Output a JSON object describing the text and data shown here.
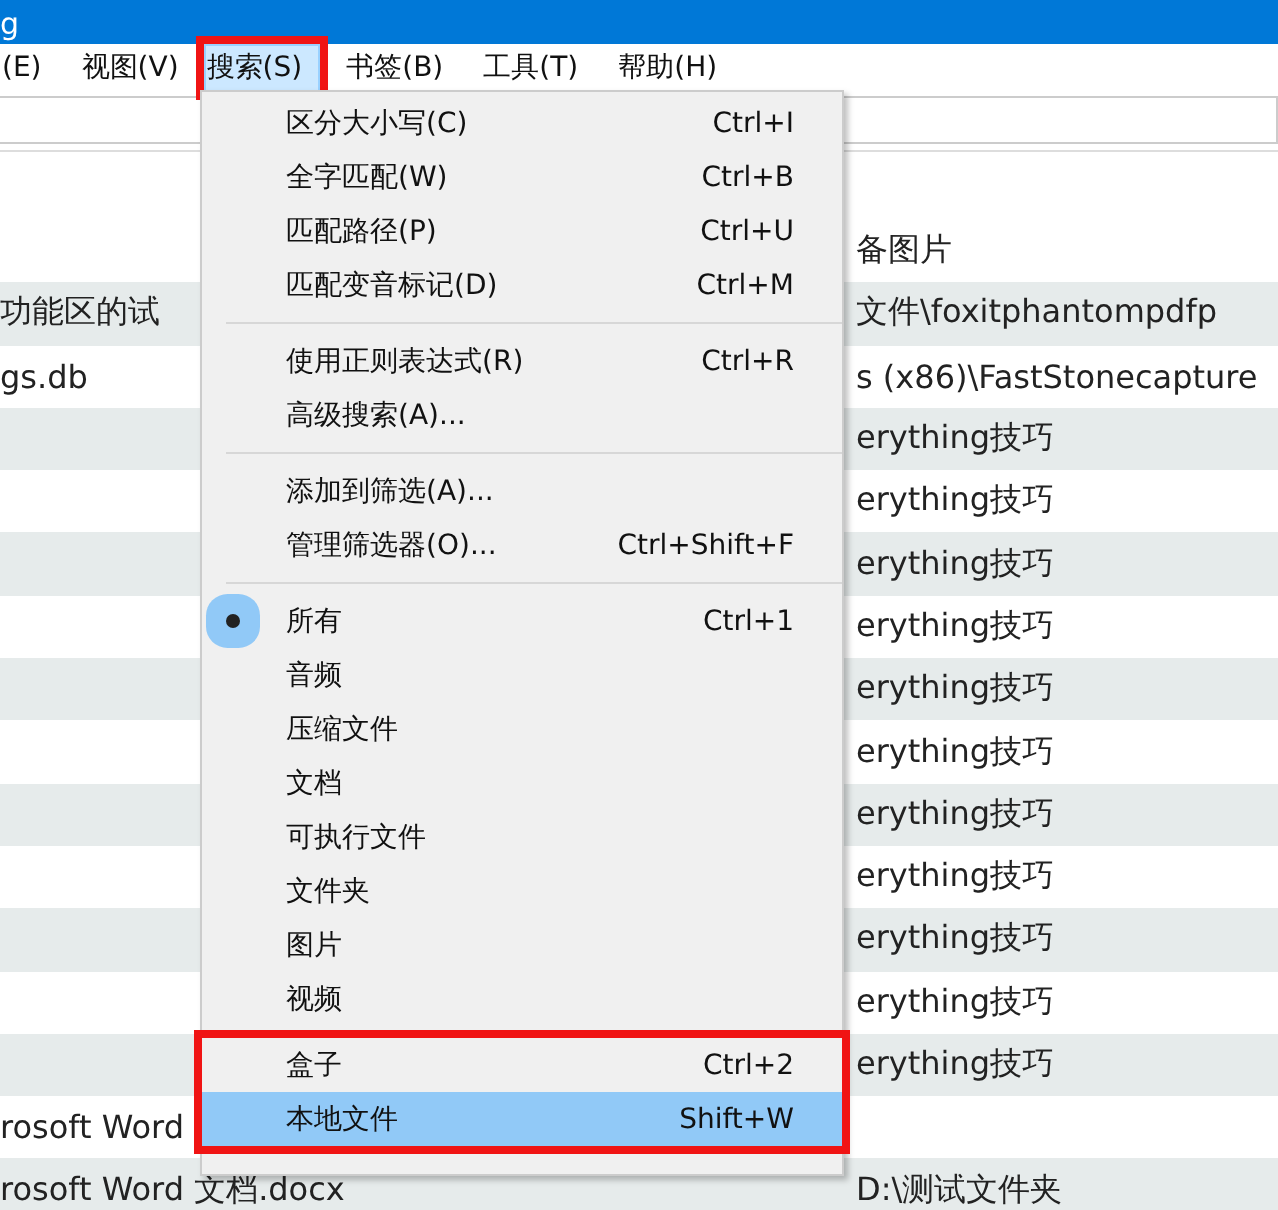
{
  "window": {
    "title": "g"
  },
  "menu_bar": [
    {
      "label": "(E)",
      "selected": false,
      "annotated": false
    },
    {
      "label": "视图(V)",
      "selected": false,
      "annotated": false
    },
    {
      "label": "搜索(S)",
      "selected": true,
      "annotated": true
    },
    {
      "label": "书签(B)",
      "selected": false,
      "annotated": false
    },
    {
      "label": "工具(T)",
      "selected": false,
      "annotated": false
    },
    {
      "label": "帮助(H)",
      "selected": false,
      "annotated": false
    }
  ],
  "file_list": {
    "rows": [
      {
        "column_1": "",
        "column_2": "备图片"
      },
      {
        "column_1": "功能区的试",
        "column_2": "文件\\foxitphantompdfp"
      },
      {
        "column_1": "gs.db",
        "column_2": "s (x86)\\FastStonecapture"
      },
      {
        "column_1": "",
        "column_2": "erything技巧"
      },
      {
        "column_1": "",
        "column_2": "erything技巧"
      },
      {
        "column_1": "",
        "column_2": "erything技巧"
      },
      {
        "column_1": "",
        "column_2": "erything技巧"
      },
      {
        "column_1": "",
        "column_2": "erything技巧"
      },
      {
        "column_1": "",
        "column_2": "erything技巧"
      },
      {
        "column_1": "",
        "column_2": "erything技巧"
      },
      {
        "column_1": "",
        "column_2": "erything技巧"
      },
      {
        "column_1": "",
        "column_2": "erything技巧"
      },
      {
        "column_1": "",
        "column_2": "erything技巧"
      },
      {
        "column_1": "",
        "column_2": "erything技巧"
      },
      {
        "column_1": "rosoft Word",
        "column_2": ""
      },
      {
        "column_1": "rosoft Word 文档.docx",
        "column_2": "D:\\测试文件夹"
      }
    ]
  },
  "menu": {
    "items": [
      {
        "kind": "item",
        "label": "区分大小写(C)",
        "shortcut": "Ctrl+I",
        "checked": false,
        "selected": false,
        "annotated": false
      },
      {
        "kind": "item",
        "label": "全字匹配(W)",
        "shortcut": "Ctrl+B",
        "checked": false,
        "selected": false,
        "annotated": false
      },
      {
        "kind": "item",
        "label": "匹配路径(P)",
        "shortcut": "Ctrl+U",
        "checked": false,
        "selected": false,
        "annotated": false
      },
      {
        "kind": "item",
        "label": "匹配变音标记(D)",
        "shortcut": "Ctrl+M",
        "checked": false,
        "selected": false,
        "annotated": false
      },
      {
        "kind": "separator"
      },
      {
        "kind": "item",
        "label": "使用正则表达式(R)",
        "shortcut": "Ctrl+R",
        "checked": false,
        "selected": false,
        "annotated": false
      },
      {
        "kind": "item",
        "label": "高级搜索(A)...",
        "checked": false,
        "selected": false,
        "annotated": false
      },
      {
        "kind": "separator"
      },
      {
        "kind": "item",
        "label": "添加到筛选(A)...",
        "checked": false,
        "selected": false,
        "annotated": false
      },
      {
        "kind": "item",
        "label": "管理筛选器(O)...",
        "shortcut": "Ctrl+Shift+F",
        "checked": false,
        "selected": false,
        "annotated": false
      },
      {
        "kind": "separator"
      },
      {
        "kind": "item",
        "label": "所有",
        "shortcut": "Ctrl+1",
        "checked": true,
        "selected": false,
        "annotated": false
      },
      {
        "kind": "item",
        "label": "音频",
        "checked": false,
        "selected": false,
        "annotated": false
      },
      {
        "kind": "item",
        "label": "压缩文件",
        "checked": false,
        "selected": false,
        "annotated": false
      },
      {
        "kind": "item",
        "label": "文档",
        "checked": false,
        "selected": false,
        "annotated": false
      },
      {
        "kind": "item",
        "label": "可执行文件",
        "checked": false,
        "selected": false,
        "annotated": false
      },
      {
        "kind": "item",
        "label": "文件夹",
        "checked": false,
        "selected": false,
        "annotated": false
      },
      {
        "kind": "item",
        "label": "图片",
        "checked": false,
        "selected": false,
        "annotated": false
      },
      {
        "kind": "item",
        "label": "视频",
        "checked": false,
        "selected": false,
        "annotated": false
      },
      {
        "kind": "item",
        "label": "盒子",
        "shortcut": "Ctrl+2",
        "checked": false,
        "selected": false,
        "annotated": true
      },
      {
        "kind": "item",
        "label": "本地文件",
        "shortcut": "Shift+W",
        "checked": false,
        "selected": true,
        "annotated": true
      }
    ]
  }
}
